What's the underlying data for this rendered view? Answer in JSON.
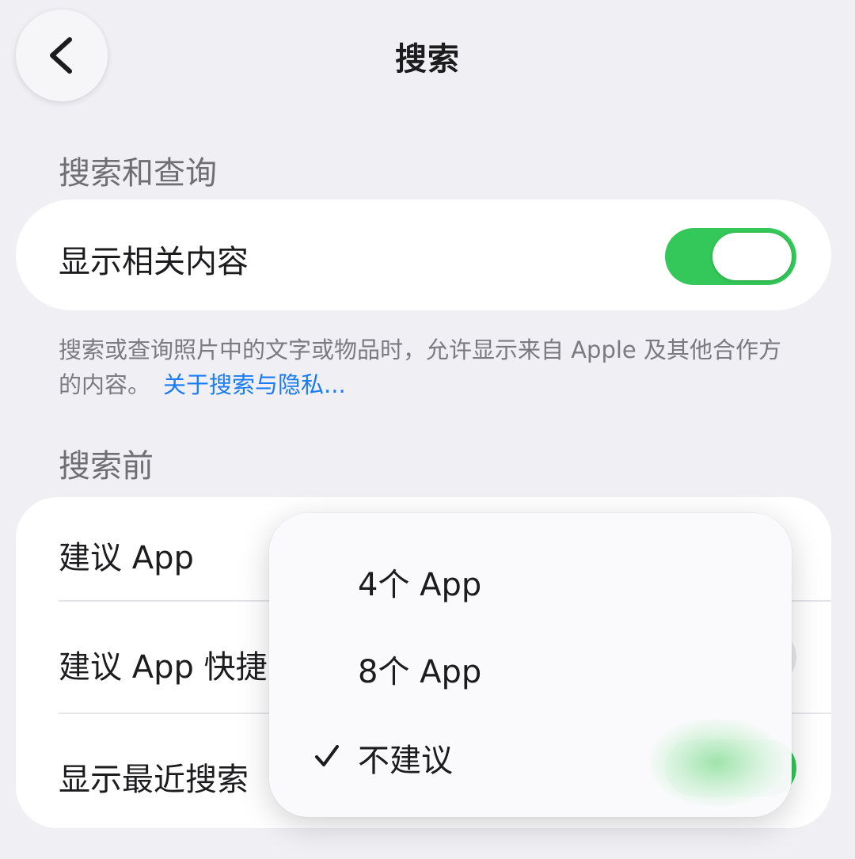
{
  "header": {
    "title": "搜索",
    "back_icon": "chevron-left-icon"
  },
  "section_search_query": {
    "header": "搜索和查询",
    "row_label": "显示相关内容",
    "toggle_on": true,
    "footer_text": "搜索或查询照片中的文字或物品时，允许显示来自 Apple 及其他合作方的内容。",
    "footer_link": "关于搜索与隐私..."
  },
  "section_before_search": {
    "header": "搜索前",
    "rows": [
      {
        "label": "建议 App"
      },
      {
        "label": "建议 App 快捷"
      },
      {
        "label": "显示最近搜索"
      }
    ]
  },
  "popup_menu": {
    "options": [
      {
        "label": "4个 App",
        "selected": false
      },
      {
        "label": "8个 App",
        "selected": false
      },
      {
        "label": "不建议",
        "selected": true
      }
    ],
    "check_icon": "checkmark-icon"
  },
  "colors": {
    "background": "#efeff4",
    "toggle_on": "#34c759",
    "link": "#1a7cf5",
    "secondary_text": "#6e6e73"
  }
}
